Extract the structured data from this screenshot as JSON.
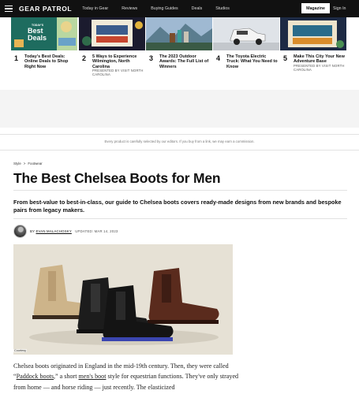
{
  "nav": {
    "brand": "GEAR PATROL",
    "links": [
      "Today in Gear",
      "Reviews",
      "Buying Guides",
      "Deals",
      "Studios"
    ],
    "magazine": "Magazine",
    "signin": "Sign In"
  },
  "trending": [
    {
      "num": "1",
      "title": "Today's Best Deals: Online Deals to Shop Right Now",
      "thumb_text_top": "TODAY'S",
      "thumb_text_main": "Best Deals",
      "sponsor": ""
    },
    {
      "num": "2",
      "title": "5 Ways to Experience Wilmington, North Carolina",
      "thumb_text_top": "",
      "thumb_text_main": "",
      "sponsor": "PRESENTED BY VISIT NORTH CAROLINA"
    },
    {
      "num": "3",
      "title": "The 2023 Outdoor Awards: The Full List of Winners",
      "thumb_text_top": "",
      "thumb_text_main": "",
      "sponsor": ""
    },
    {
      "num": "4",
      "title": "The Toyota Electric Truck: What You Need to Know",
      "thumb_text_top": "",
      "thumb_text_main": "",
      "sponsor": ""
    },
    {
      "num": "5",
      "title": "Make This City Your New Adventure Base",
      "thumb_text_top": "",
      "thumb_text_main": "",
      "sponsor": "PRESENTED BY VISIT NORTH CAROLINA"
    }
  ],
  "disclaimer": "Every product is carefully selected by our editors. If you buy from a link, we may earn a commission.",
  "breadcrumb": {
    "section": "Style",
    "separator": ">",
    "subsection": "Footwear"
  },
  "article": {
    "title": "The Best Chelsea Boots for Men",
    "dek": "From best-value to best-in-class, our guide to Chelsea boots covers ready-made designs from new brands and bespoke pairs from legacy makers.",
    "by": "BY",
    "author": "EVAN MALACHOSKY",
    "updated": "UPDATED: MAR 14, 2023",
    "courtesy": "Courtesy",
    "body_p1_a": "Chelsea boots originated in England in the mid-19th century. Then, they were called “",
    "body_link1": "Paddock boots",
    "body_p1_b": ",” a short ",
    "body_link2": "men's boot",
    "body_p1_c": " style for equestrian functions. They've only strayed from home — and horse riding — just recently. The elasticized"
  },
  "colors": {
    "nav_bg": "#111111",
    "deals_teal": "#1d6f62",
    "ad_bg": "#f4f4f4"
  }
}
